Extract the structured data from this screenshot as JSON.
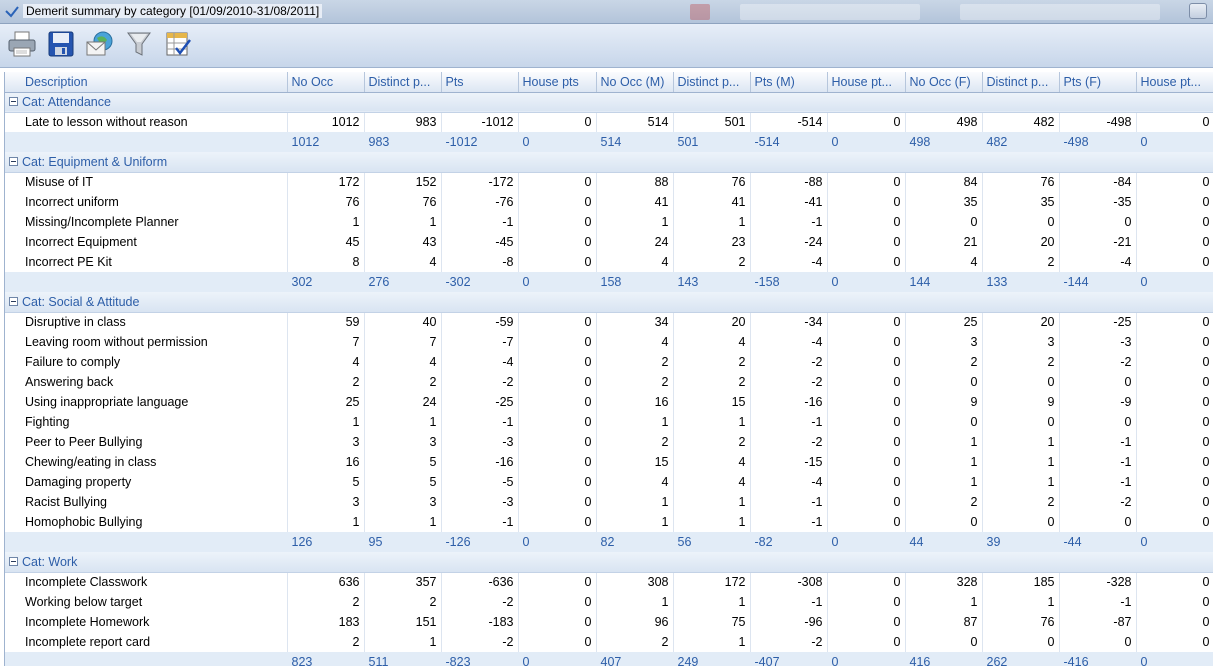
{
  "window": {
    "title": "Demerit summary by category [01/09/2010-31/08/2011]"
  },
  "toolbar": {
    "buttons": [
      {
        "icon": "printer-icon"
      },
      {
        "icon": "save-icon"
      },
      {
        "icon": "email-icon"
      },
      {
        "icon": "filter-icon"
      },
      {
        "icon": "column-chooser-icon"
      }
    ]
  },
  "table": {
    "columns": [
      "Description",
      "No Occ",
      "Distinct p...",
      "Pts",
      "House pts",
      "No Occ (M)",
      "Distinct p...",
      "Pts (M)",
      "House pt...",
      "No Occ (F)",
      "Distinct p...",
      "Pts (F)",
      "House pt..."
    ],
    "groups": [
      {
        "label": "Cat: Attendance",
        "rows": [
          {
            "desc": "Late to lesson without reason",
            "values": [
              "1012",
              "983",
              "-1012",
              "0",
              "514",
              "501",
              "-514",
              "0",
              "498",
              "482",
              "-498",
              "0"
            ]
          }
        ],
        "totals": [
          "1012",
          "983",
          "-1012",
          "0",
          "514",
          "501",
          "-514",
          "0",
          "498",
          "482",
          "-498",
          "0"
        ]
      },
      {
        "label": "Cat: Equipment & Uniform",
        "rows": [
          {
            "desc": "Misuse of IT",
            "values": [
              "172",
              "152",
              "-172",
              "0",
              "88",
              "76",
              "-88",
              "0",
              "84",
              "76",
              "-84",
              "0"
            ]
          },
          {
            "desc": "Incorrect uniform",
            "values": [
              "76",
              "76",
              "-76",
              "0",
              "41",
              "41",
              "-41",
              "0",
              "35",
              "35",
              "-35",
              "0"
            ]
          },
          {
            "desc": "Missing/Incomplete Planner",
            "values": [
              "1",
              "1",
              "-1",
              "0",
              "1",
              "1",
              "-1",
              "0",
              "0",
              "0",
              "0",
              "0"
            ]
          },
          {
            "desc": "Incorrect Equipment",
            "values": [
              "45",
              "43",
              "-45",
              "0",
              "24",
              "23",
              "-24",
              "0",
              "21",
              "20",
              "-21",
              "0"
            ]
          },
          {
            "desc": "Incorrect PE Kit",
            "values": [
              "8",
              "4",
              "-8",
              "0",
              "4",
              "2",
              "-4",
              "0",
              "4",
              "2",
              "-4",
              "0"
            ]
          }
        ],
        "totals": [
          "302",
          "276",
          "-302",
          "0",
          "158",
          "143",
          "-158",
          "0",
          "144",
          "133",
          "-144",
          "0"
        ]
      },
      {
        "label": "Cat: Social & Attitude",
        "rows": [
          {
            "desc": "Disruptive in class",
            "values": [
              "59",
              "40",
              "-59",
              "0",
              "34",
              "20",
              "-34",
              "0",
              "25",
              "20",
              "-25",
              "0"
            ]
          },
          {
            "desc": "Leaving room without permission",
            "values": [
              "7",
              "7",
              "-7",
              "0",
              "4",
              "4",
              "-4",
              "0",
              "3",
              "3",
              "-3",
              "0"
            ]
          },
          {
            "desc": "Failure to comply",
            "values": [
              "4",
              "4",
              "-4",
              "0",
              "2",
              "2",
              "-2",
              "0",
              "2",
              "2",
              "-2",
              "0"
            ]
          },
          {
            "desc": "Answering back",
            "values": [
              "2",
              "2",
              "-2",
              "0",
              "2",
              "2",
              "-2",
              "0",
              "0",
              "0",
              "0",
              "0"
            ]
          },
          {
            "desc": "Using inappropriate language",
            "values": [
              "25",
              "24",
              "-25",
              "0",
              "16",
              "15",
              "-16",
              "0",
              "9",
              "9",
              "-9",
              "0"
            ]
          },
          {
            "desc": "Fighting",
            "values": [
              "1",
              "1",
              "-1",
              "0",
              "1",
              "1",
              "-1",
              "0",
              "0",
              "0",
              "0",
              "0"
            ]
          },
          {
            "desc": "Peer to Peer Bullying",
            "values": [
              "3",
              "3",
              "-3",
              "0",
              "2",
              "2",
              "-2",
              "0",
              "1",
              "1",
              "-1",
              "0"
            ]
          },
          {
            "desc": "Chewing/eating in class",
            "values": [
              "16",
              "5",
              "-16",
              "0",
              "15",
              "4",
              "-15",
              "0",
              "1",
              "1",
              "-1",
              "0"
            ]
          },
          {
            "desc": "Damaging property",
            "values": [
              "5",
              "5",
              "-5",
              "0",
              "4",
              "4",
              "-4",
              "0",
              "1",
              "1",
              "-1",
              "0"
            ]
          },
          {
            "desc": "Racist Bullying",
            "values": [
              "3",
              "3",
              "-3",
              "0",
              "1",
              "1",
              "-1",
              "0",
              "2",
              "2",
              "-2",
              "0"
            ]
          },
          {
            "desc": "Homophobic Bullying",
            "values": [
              "1",
              "1",
              "-1",
              "0",
              "1",
              "1",
              "-1",
              "0",
              "0",
              "0",
              "0",
              "0"
            ]
          }
        ],
        "totals": [
          "126",
          "95",
          "-126",
          "0",
          "82",
          "56",
          "-82",
          "0",
          "44",
          "39",
          "-44",
          "0"
        ]
      },
      {
        "label": "Cat: Work",
        "rows": [
          {
            "desc": " Incomplete Classwork",
            "values": [
              "636",
              "357",
              "-636",
              "0",
              "308",
              "172",
              "-308",
              "0",
              "328",
              "185",
              "-328",
              "0"
            ]
          },
          {
            "desc": "Working below target",
            "values": [
              "2",
              "2",
              "-2",
              "0",
              "1",
              "1",
              "-1",
              "0",
              "1",
              "1",
              "-1",
              "0"
            ]
          },
          {
            "desc": "Incomplete Homework",
            "values": [
              "183",
              "151",
              "-183",
              "0",
              "96",
              "75",
              "-96",
              "0",
              "87",
              "76",
              "-87",
              "0"
            ]
          },
          {
            "desc": "Incomplete report card",
            "values": [
              "2",
              "1",
              "-2",
              "0",
              "2",
              "1",
              "-2",
              "0",
              "0",
              "0",
              "0",
              "0"
            ]
          }
        ],
        "totals": [
          "823",
          "511",
          "-823",
          "0",
          "407",
          "249",
          "-407",
          "0",
          "416",
          "262",
          "-416",
          "0"
        ]
      }
    ]
  },
  "colors": {
    "header_text": "#2d5ea8",
    "total_row_bg": "#e2ecf7",
    "toolbar_bg": "#d6e2f1"
  }
}
